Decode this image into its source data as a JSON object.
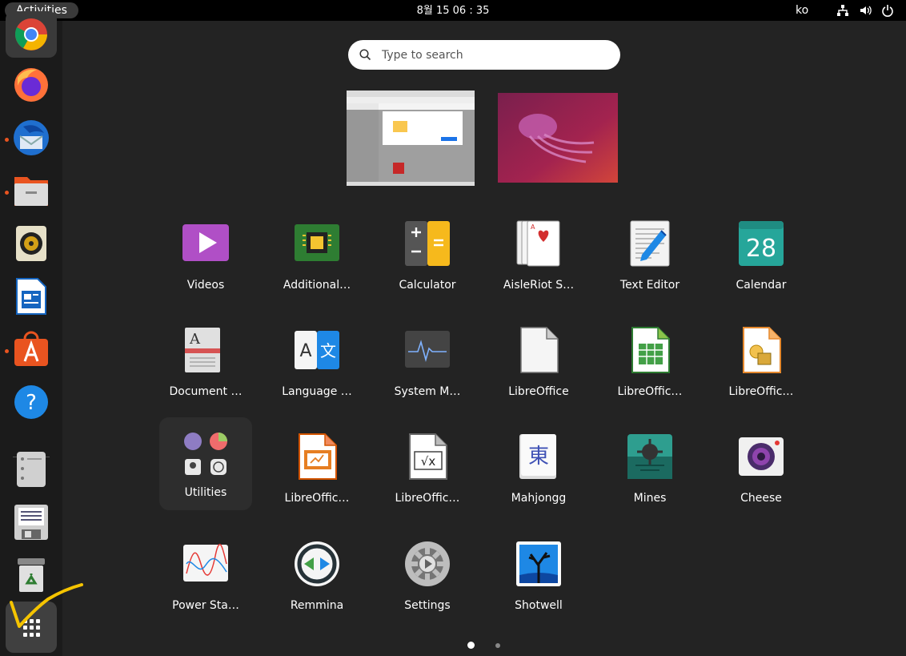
{
  "topbar": {
    "activities": "Activities",
    "clock": "8월 15  06 : 35",
    "lang": "ko",
    "tray_icons": [
      "network-icon",
      "volume-icon",
      "power-icon"
    ]
  },
  "dock": {
    "items": [
      "google-chrome",
      "firefox",
      "thunderbird",
      "files",
      "rhythmbox",
      "libreoffice-writer",
      "ubuntu-software",
      "help",
      "drive",
      "save-disk",
      "trash"
    ],
    "show_apps": "show-applications"
  },
  "search": {
    "placeholder": "Type to search"
  },
  "apps": [
    {
      "label": "Videos",
      "icon": "videos-icon"
    },
    {
      "label": "Additional…",
      "icon": "additional-drivers-icon"
    },
    {
      "label": "Calculator",
      "icon": "calculator-icon"
    },
    {
      "label": "AisleRiot S…",
      "icon": "aisleriot-icon"
    },
    {
      "label": "Text Editor",
      "icon": "text-editor-icon"
    },
    {
      "label": "Calendar",
      "icon": "calendar-icon",
      "text": "28"
    },
    {
      "label": "Document …",
      "icon": "document-viewer-icon",
      "text": "A"
    },
    {
      "label": "Language …",
      "icon": "language-support-icon",
      "text": "A",
      "text2": "文"
    },
    {
      "label": "System M…",
      "icon": "system-monitor-icon"
    },
    {
      "label": "LibreOffice",
      "icon": "libreoffice-icon"
    },
    {
      "label": "LibreOffic…",
      "icon": "libreoffice-calc-icon"
    },
    {
      "label": "LibreOffic…",
      "icon": "libreoffice-draw-icon"
    },
    {
      "label": "Utilities",
      "icon": "utilities-folder-icon"
    },
    {
      "label": "LibreOffic…",
      "icon": "libreoffice-impress-icon"
    },
    {
      "label": "LibreOffic…",
      "icon": "libreoffice-math-icon",
      "text": "√x"
    },
    {
      "label": "Mahjongg",
      "icon": "mahjongg-icon",
      "text": "東"
    },
    {
      "label": "Mines",
      "icon": "mines-icon"
    },
    {
      "label": "Cheese",
      "icon": "cheese-icon"
    },
    {
      "label": "Power Sta…",
      "icon": "power-statistics-icon"
    },
    {
      "label": "Remmina",
      "icon": "remmina-icon"
    },
    {
      "label": "Settings",
      "icon": "settings-icon"
    },
    {
      "label": "Shotwell",
      "icon": "shotwell-icon"
    }
  ],
  "pager": {
    "pages": 2,
    "current": 1
  },
  "colors": {
    "accent": "#e95420",
    "background": "#232323",
    "dock": "#1b1b1b",
    "annotation": "#f5c400"
  }
}
